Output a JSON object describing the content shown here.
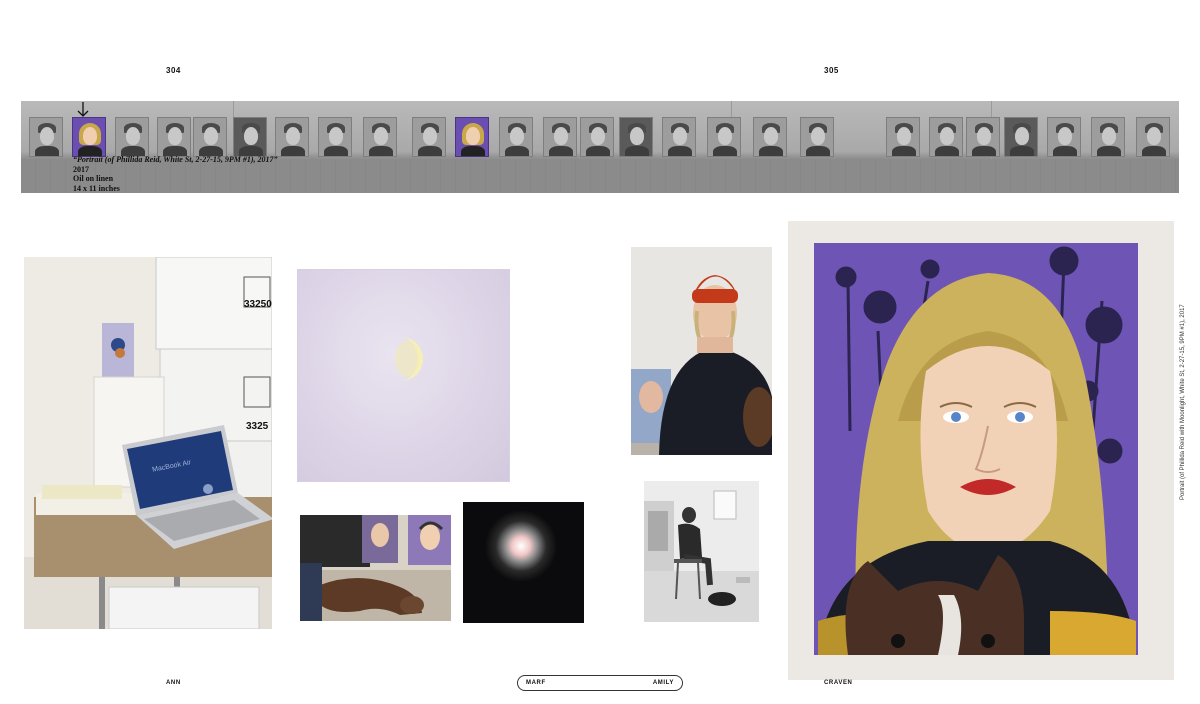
{
  "page_numbers": {
    "left": "304",
    "right": "305"
  },
  "caption": {
    "title": "“Portrait (of Phillida Reid, White St, 2-27-15, 9PM #1), 2017”",
    "year": "2017",
    "medium": "Oil on linen",
    "dimensions": "14 x 11 inches"
  },
  "box_labels": [
    "33250",
    "3325"
  ],
  "laptop_label": "MacBook Air",
  "side_caption": "Portrait (of Phillida Reid with Moonlight, White St, 2-27-15, 9PM #1), 2017",
  "footer": {
    "left": "ANN",
    "pill_left": "MARF",
    "pill_right": "AMILY",
    "right": "CRAVEN"
  },
  "colors": {
    "painting_background": "#6e55b5",
    "hair": "#cdb25d",
    "hat": "#c23a1a",
    "sweater": "#1b1d26"
  }
}
